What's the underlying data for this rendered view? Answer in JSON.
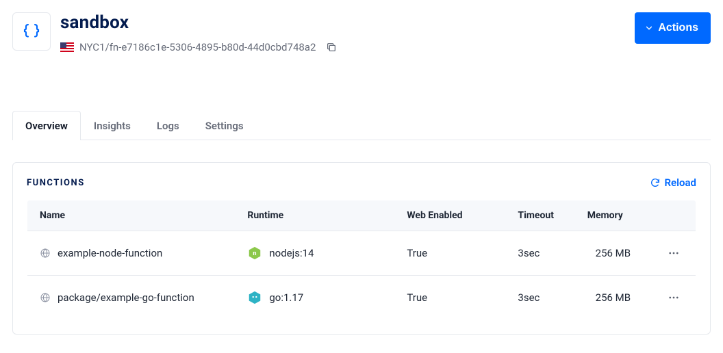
{
  "header": {
    "title": "sandbox",
    "region": "NYC1",
    "separator": " / ",
    "resource_id": "fn-e7186c1e-5306-4895-b80d-44d0cbd748a2",
    "actions_label": "Actions"
  },
  "tabs": [
    {
      "label": "Overview",
      "active": true
    },
    {
      "label": "Insights",
      "active": false
    },
    {
      "label": "Logs",
      "active": false
    },
    {
      "label": "Settings",
      "active": false
    }
  ],
  "functions_panel": {
    "title": "FUNCTIONS",
    "reload_label": "Reload",
    "columns": {
      "name": "Name",
      "runtime": "Runtime",
      "web_enabled": "Web Enabled",
      "timeout": "Timeout",
      "memory": "Memory"
    },
    "rows": [
      {
        "name": "example-node-function",
        "runtime": "nodejs:14",
        "runtime_icon": "node",
        "web_enabled": "True",
        "timeout": "3sec",
        "memory": "256 MB"
      },
      {
        "name": "package/example-go-function",
        "runtime": "go:1.17",
        "runtime_icon": "go",
        "web_enabled": "True",
        "timeout": "3sec",
        "memory": "256 MB"
      }
    ]
  },
  "colors": {
    "accent": "#0069ff"
  }
}
